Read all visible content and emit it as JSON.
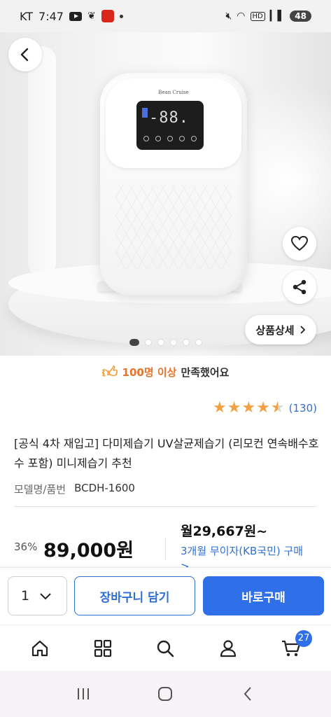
{
  "status_bar": {
    "carrier": "KT",
    "time": "7:47",
    "battery": "48"
  },
  "hero": {
    "brand": "Bean Cruise",
    "display_digits": "-88.",
    "detail_button_label": "상품상세",
    "pager_count": 6,
    "pager_active": 0
  },
  "satisfaction": {
    "highlight": "100명 이상",
    "text": "만족했어요"
  },
  "rating": {
    "value": 4.5,
    "count": "(130)"
  },
  "product": {
    "title": "[공식 4차 재입고] 다미제습기 UV살균제습기 (리모컨 연속배수호수 포함) 미니제습기 추천",
    "model_label": "모델명/품번",
    "model_value": "BCDH-1600"
  },
  "pricing": {
    "discount": "36%",
    "price": "89,000원",
    "monthly": "월29,667원~",
    "installment": "3개월 무이자(KB국민) 구매 >"
  },
  "purchase": {
    "quantity": "1",
    "cart_label": "장바구니 담기",
    "buy_label": "바로구매"
  },
  "bottom_nav": {
    "cart_count": "27"
  },
  "colors": {
    "accent_blue": "#2f6fe8",
    "link_blue": "#2f6fd0",
    "star": "#f2a041",
    "highlight_orange": "#e8742b"
  }
}
